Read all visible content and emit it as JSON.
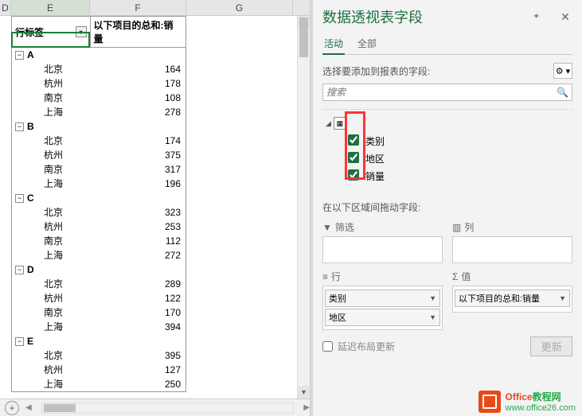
{
  "columns": {
    "D": "D",
    "E": "E",
    "F": "F",
    "G": "G"
  },
  "pivot": {
    "header_rowlabels": "行标签",
    "header_sum": "以下项目的总和:销量",
    "groups": [
      {
        "name": "A",
        "rows": [
          {
            "city": "北京",
            "val": "164"
          },
          {
            "city": "杭州",
            "val": "178"
          },
          {
            "city": "南京",
            "val": "108"
          },
          {
            "city": "上海",
            "val": "278"
          }
        ]
      },
      {
        "name": "B",
        "rows": [
          {
            "city": "北京",
            "val": "174"
          },
          {
            "city": "杭州",
            "val": "375"
          },
          {
            "city": "南京",
            "val": "317"
          },
          {
            "city": "上海",
            "val": "196"
          }
        ]
      },
      {
        "name": "C",
        "rows": [
          {
            "city": "北京",
            "val": "323"
          },
          {
            "city": "杭州",
            "val": "253"
          },
          {
            "city": "南京",
            "val": "112"
          },
          {
            "city": "上海",
            "val": "272"
          }
        ]
      },
      {
        "name": "D",
        "rows": [
          {
            "city": "北京",
            "val": "289"
          },
          {
            "city": "杭州",
            "val": "122"
          },
          {
            "city": "南京",
            "val": "170"
          },
          {
            "city": "上海",
            "val": "394"
          }
        ]
      },
      {
        "name": "E",
        "rows": [
          {
            "city": "北京",
            "val": "395"
          },
          {
            "city": "杭州",
            "val": "127"
          },
          {
            "city": "上海",
            "val": "250"
          }
        ]
      }
    ]
  },
  "pane": {
    "title": "数据透视表字段",
    "tab_active": "活动",
    "tab_all": "全部",
    "instruction": "选择要添加到报表的字段:",
    "search_placeholder": "搜索",
    "fields": {
      "f1": "类别",
      "f2": "地区",
      "f3": "销量"
    },
    "areas_label": "在以下区域间拖动字段:",
    "filter_title": "筛选",
    "columns_title": "列",
    "rows_title": "行",
    "values_title": "值",
    "row_items": {
      "r1": "类别",
      "r2": "地区"
    },
    "value_items": {
      "v1": "以下项目的总和:销量"
    },
    "defer_label": "延迟布局更新",
    "update_btn": "更新"
  },
  "watermark": {
    "line1a": "Office",
    "line1b": "教程网",
    "line2": "www.office26.com"
  }
}
